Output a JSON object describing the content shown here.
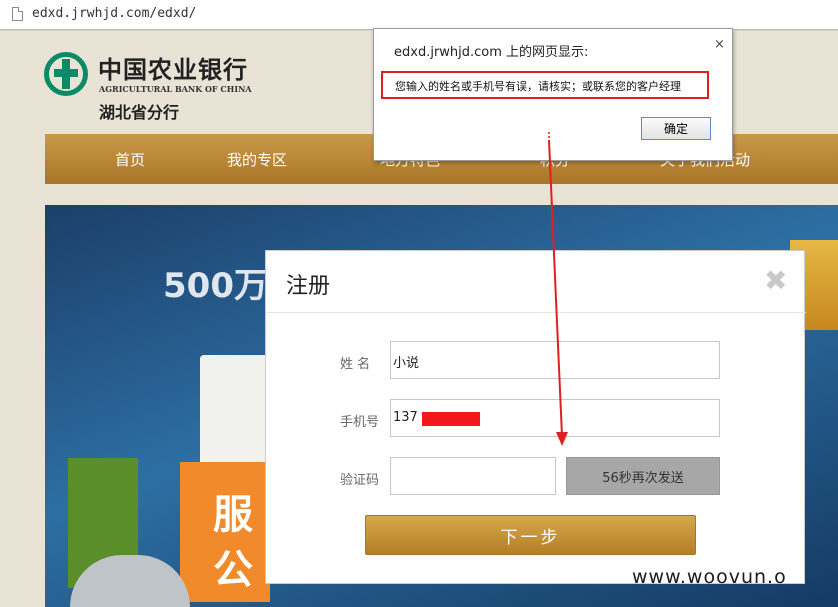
{
  "browser": {
    "url": "edxd.jrwhjd.com/edxd/"
  },
  "site": {
    "bank_name": "中国农业银行",
    "bank_name_en": "AGRICULTURAL BANK OF CHINA",
    "branch": "湖北省分行",
    "nav": [
      "首页",
      "我的专区",
      "地方特色",
      "积分",
      "关于我们活动"
    ],
    "banner_text": "500万",
    "banner_chars": [
      "服",
      "公"
    ]
  },
  "alert": {
    "title": "edxd.jrwhjd.com 上的网页显示:",
    "message": "您输入的姓名或手机号有误，请核实；或联系您的客户经理",
    "ok_label": "确定",
    "close_glyph": "×"
  },
  "modal": {
    "title": "注册",
    "close_glyph": "✖",
    "name_label": "姓 名",
    "name_value": "小说",
    "phone_label": "手机号",
    "phone_value": "137",
    "code_label": "验证码",
    "code_value": "",
    "resend_label": "56秒再次发送",
    "next_label": "下一步"
  },
  "watermark": "www.woovun.o",
  "colors": {
    "accent_gold": "#b47f27",
    "alert_border": "#e02020",
    "bank_green": "#0a8a66"
  }
}
